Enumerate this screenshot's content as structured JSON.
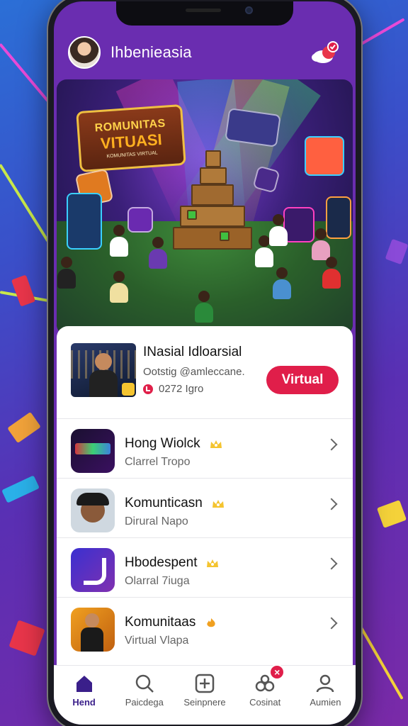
{
  "header": {
    "title": "Ihbenieasia",
    "avatar_icon": "user-avatar",
    "cloud_icon": "cloud-notification-icon"
  },
  "hero": {
    "logo_line1": "ROMUNITAS",
    "logo_line2": "VITUASI",
    "logo_line3": "KOMUNITAS VIRTUAL"
  },
  "featured": {
    "title": "INasial Idloarsial",
    "subtitle": "Ootstig @amleccane.",
    "meta": "0272 Igro",
    "button_label": "Virtual"
  },
  "list": [
    {
      "name": "Hong Wiolck",
      "sub": "Clarrel Tropo",
      "badge": "crown"
    },
    {
      "name": "Komunticasn",
      "sub": "Dirural Napo",
      "badge": "crown"
    },
    {
      "name": "Hbodespent",
      "sub": "Olarral 7iuga",
      "badge": "crown"
    },
    {
      "name": "Komunitaas",
      "sub": "Virtual Vlapa",
      "badge": "flame"
    }
  ],
  "nav": [
    {
      "label": "Hend",
      "icon": "home-icon",
      "active": true
    },
    {
      "label": "Paicdega",
      "icon": "search-icon"
    },
    {
      "label": "Seinpnere",
      "icon": "plus-icon"
    },
    {
      "label": "Cosinat",
      "icon": "community-icon",
      "badge": "×"
    },
    {
      "label": "Aumien",
      "icon": "profile-icon"
    }
  ],
  "colors": {
    "accent": "#e01e4a",
    "header_bg": "#6a2db0",
    "active_nav": "#3a1f8a"
  }
}
